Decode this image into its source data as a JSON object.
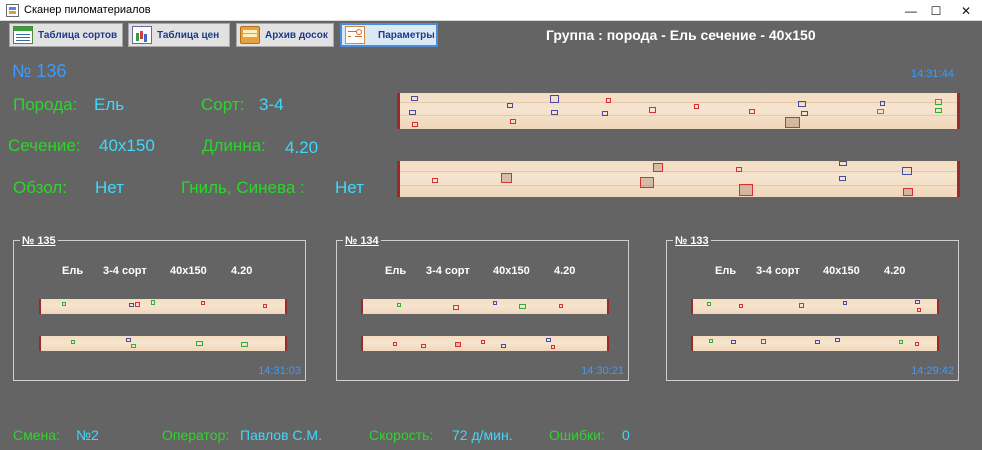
{
  "window": {
    "title": "Сканер пиломатериалов"
  },
  "toolbar": {
    "grades_table": "Таблица сортов",
    "prices_table": "Таблица цен",
    "boards_archive": "Архив досок",
    "parameters": "Параметры"
  },
  "group_line": "Группа :  порода - Ель  сечение - 40х150",
  "current": {
    "number": "№ 136",
    "time": "14:31:44",
    "species_label": "Порода:",
    "species": "Ель",
    "grade_label": "Сорт:",
    "grade": "3-4",
    "section_label": "Сечение:",
    "section": "40х150",
    "length_label": "Длинна:",
    "length": "4.20",
    "wane_label": "Обзол:",
    "wane": "Нет",
    "rot_label": "Гниль, Синева :",
    "rot": "Нет"
  },
  "history": [
    {
      "number": "№ 135",
      "species": "Ель",
      "grade": "3-4 сорт",
      "section": "40х150",
      "length": "4.20",
      "time": "14:31:03"
    },
    {
      "number": "№ 134",
      "species": "Ель",
      "grade": "3-4 сорт",
      "section": "40х150",
      "length": "4.20",
      "time": "14:30:21"
    },
    {
      "number": "№ 133",
      "species": "Ель",
      "grade": "3-4 сорт",
      "section": "40х150",
      "length": "4.20",
      "time": "14:29:42"
    }
  ],
  "status": {
    "shift_label": "Смена:",
    "shift": "№2",
    "operator_label": "Оператор:",
    "operator": "Павлов С.М.",
    "speed_label": "Скорость:",
    "speed": "72 д/мин.",
    "errors_label": "Ошибки:",
    "errors": "0"
  },
  "colors": {
    "background": "#646464",
    "label_green": "#2bd62b",
    "value_cyan": "#3cd9ff",
    "number_blue": "#3b9bff"
  }
}
